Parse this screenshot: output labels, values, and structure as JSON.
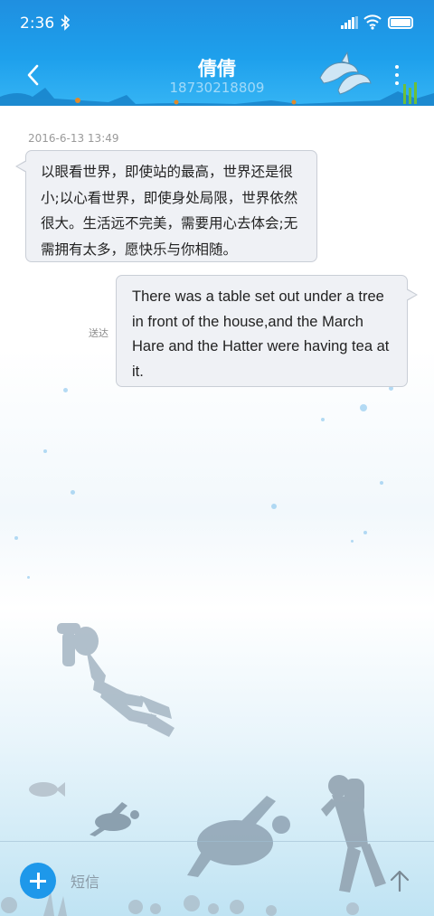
{
  "status_bar": {
    "time": "2:36",
    "bluetooth_icon": "bluetooth-icon",
    "signal_icon": "signal-icon",
    "wifi_icon": "wifi-icon",
    "battery_icon": "battery-icon"
  },
  "header": {
    "title": "倩倩",
    "phone": "18730218809",
    "back_icon": "chevron-left-icon",
    "more_icon": "more-vertical-icon",
    "background_color": "#1ea0ec"
  },
  "conversation": {
    "timestamp": "2016-6-13 13:49",
    "messages": [
      {
        "direction": "incoming",
        "text": "以眼看世界，即使站的最高，世界还是很小;以心看世界，即使身处局限，世界依然很大。生活远不完美，需要用心去体会;无需拥有太多，愿快乐与你相随。"
      },
      {
        "direction": "outgoing",
        "text": "There was a table set out under a tree in front of the house,and the March Hare and the Hatter were having tea at it.",
        "status": "送达"
      }
    ]
  },
  "composer": {
    "placeholder": "短信",
    "add_icon": "plus-icon",
    "send_icon": "arrow-up-icon",
    "accent_color": "#1e98ea"
  }
}
